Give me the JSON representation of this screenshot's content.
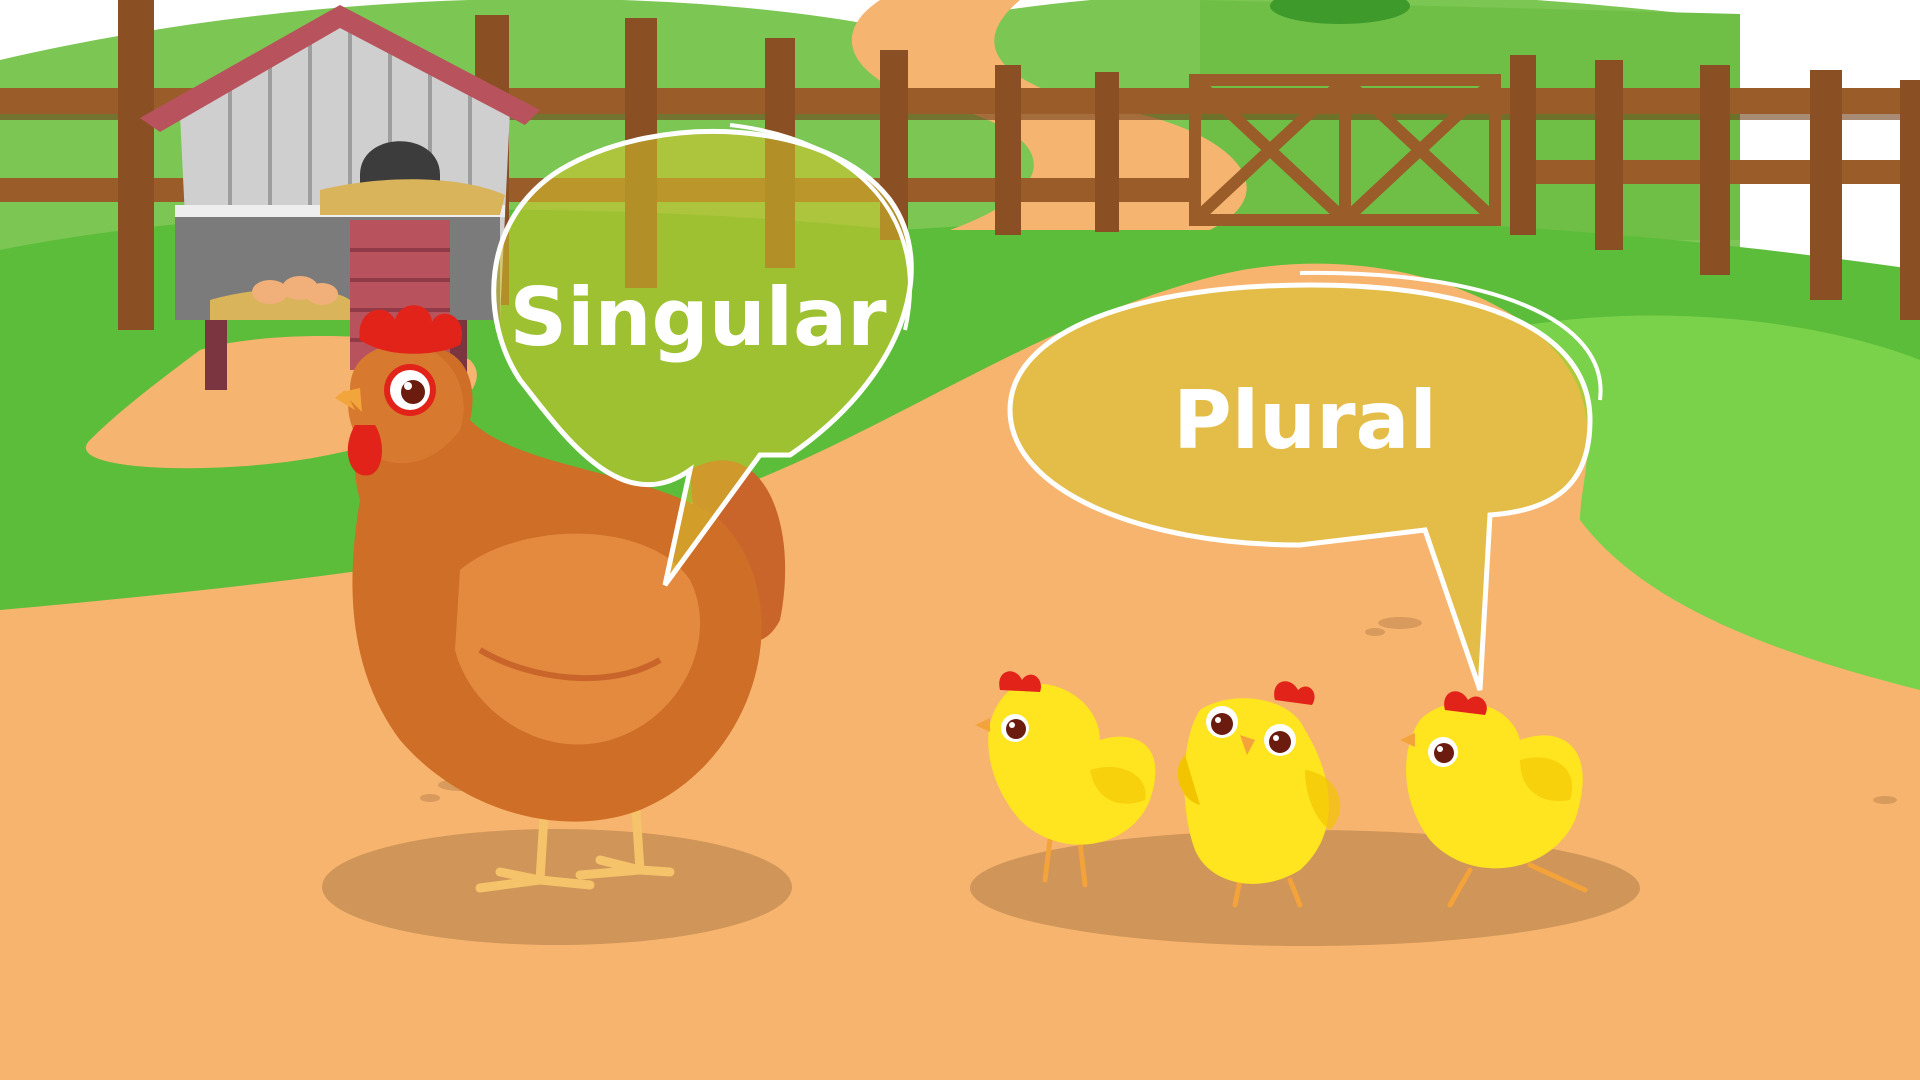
{
  "bubbles": {
    "singular": {
      "label": "Singular"
    },
    "plural": {
      "label": "Plural"
    }
  },
  "colors": {
    "sky": "#ffffff",
    "hill_far": "#79c651",
    "hill_near": "#6bc23f",
    "grass": "#5cbc3a",
    "grass_dark": "#3f9a2c",
    "path": "#f7b46e",
    "fence": "#9a5d2a",
    "fence_dark": "#6e3d17",
    "coop_wall": "#c9c9c9",
    "coop_roof": "#b8535e",
    "hen_body": "#cf6e27",
    "hen_light": "#e38a3f",
    "comb": "#e2231a",
    "chick": "#ffe51f",
    "chick_shade": "#f2c400",
    "shadow": "#c98f55",
    "bubble_fill": "#d6c42c",
    "bubble_stroke": "#ffffff"
  }
}
